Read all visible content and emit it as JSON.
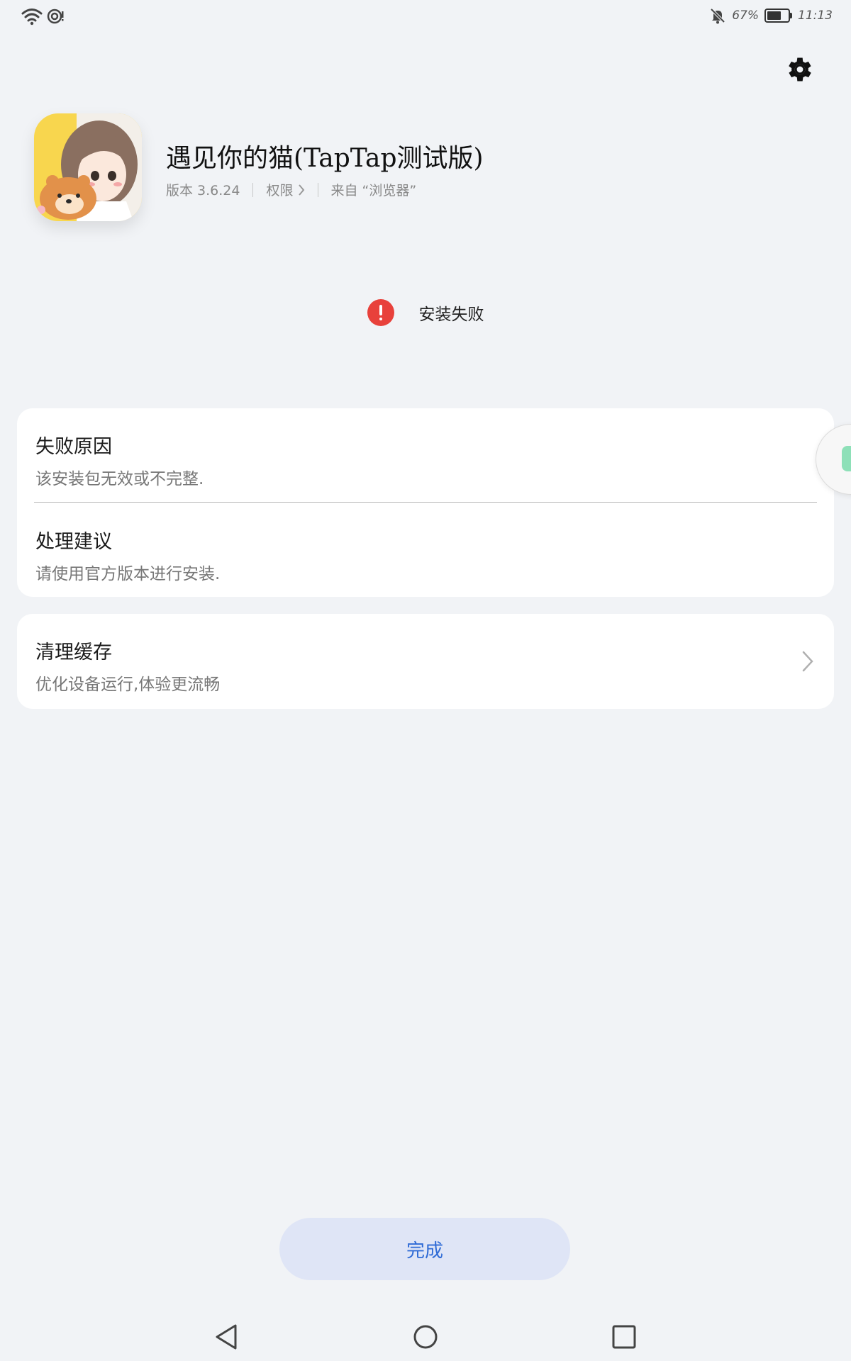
{
  "status_bar": {
    "battery_percent": "67%",
    "battery_level": 0.67,
    "time": "11:13",
    "icons": [
      "wifi-icon",
      "hotspot-icon",
      "bell-muted-icon"
    ]
  },
  "header": {
    "settings_icon": "gear-icon",
    "app_name": "遇见你的猫(TapTap测试版)",
    "version": "版本 3.6.24",
    "permissions": "权限",
    "source": "来自 “浏览器”"
  },
  "install_status": {
    "icon": "error-icon",
    "color": "#e8413b",
    "text": "安装失败"
  },
  "info_card": {
    "reason_title": "失败原因",
    "reason_text": "该安装包无效或不完整.",
    "advice_title": "处理建议",
    "advice_text": "请使用官方版本进行安装."
  },
  "clean_card": {
    "title": "清理缓存",
    "subtitle": "优化设备运行,体验更流畅"
  },
  "done_button": {
    "label": "完成",
    "accent": "#2f6bd6"
  },
  "nav_bar": {
    "items": [
      "back-icon",
      "home-icon",
      "recents-icon"
    ]
  }
}
